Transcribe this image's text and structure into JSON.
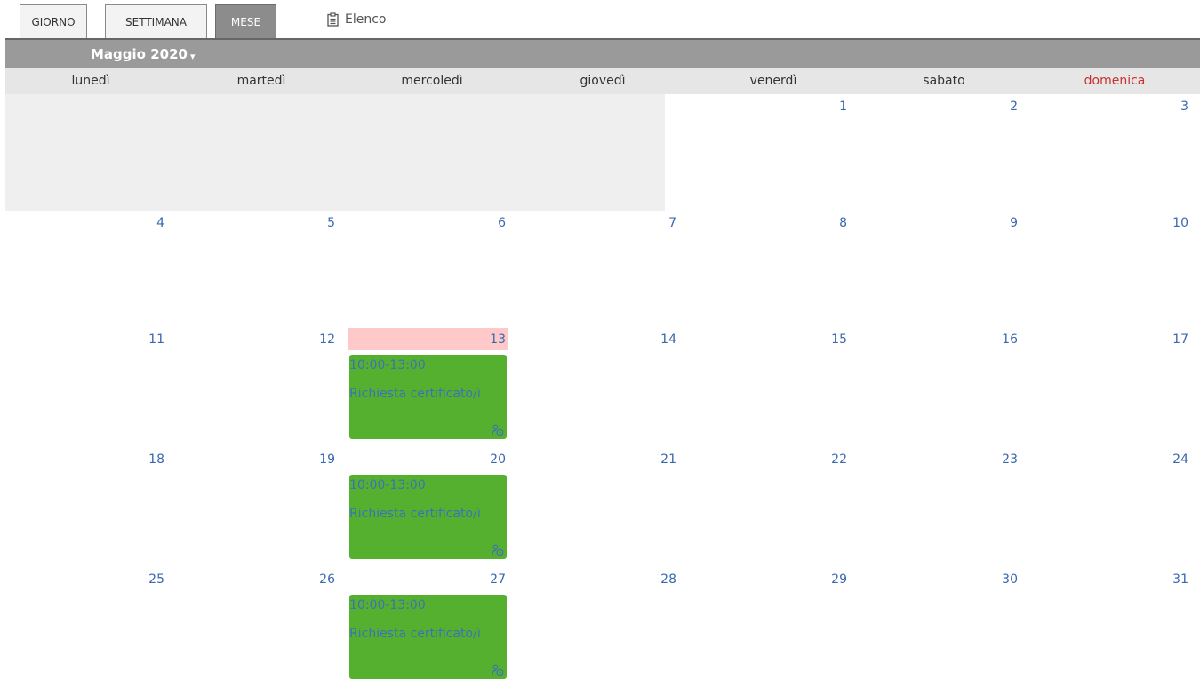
{
  "toolbar": {
    "views": [
      {
        "label": "GIORNO",
        "active": false
      },
      {
        "label": "SETTIMANA",
        "active": false
      },
      {
        "label": "MESE",
        "active": true
      }
    ],
    "list_label": "Elenco",
    "list_icon": "clipboard-icon"
  },
  "calendar": {
    "month_title": "Maggio 2020",
    "weekdays": [
      "lunedì",
      "martedì",
      "mercoledì",
      "giovedì",
      "venerdì",
      "sabato",
      "domenica"
    ],
    "today": "13",
    "weeks": [
      [
        "",
        "",
        "",
        "",
        "1",
        "2",
        "3"
      ],
      [
        "4",
        "5",
        "6",
        "7",
        "8",
        "9",
        "10"
      ],
      [
        "11",
        "12",
        "13",
        "14",
        "15",
        "16",
        "17"
      ],
      [
        "18",
        "19",
        "20",
        "21",
        "22",
        "23",
        "24"
      ],
      [
        "25",
        "26",
        "27",
        "28",
        "29",
        "30",
        "31"
      ]
    ],
    "events": [
      {
        "day": "13",
        "time": "10:00-13:00",
        "title": "Richiesta certificato/i",
        "icon": "user-clock-icon"
      },
      {
        "day": "20",
        "time": "10:00-13:00",
        "title": "Richiesta certificato/i",
        "icon": "user-clock-icon"
      },
      {
        "day": "27",
        "time": "10:00-13:00",
        "title": "Richiesta certificato/i",
        "icon": "user-clock-icon"
      }
    ]
  },
  "colors": {
    "event_bg": "#55b030",
    "event_text": "#3d73b3",
    "today_bg": "#ffc9c9",
    "day_number": "#3a68b0",
    "sunday": "#c83030",
    "month_bar": "#9a9a9a"
  }
}
